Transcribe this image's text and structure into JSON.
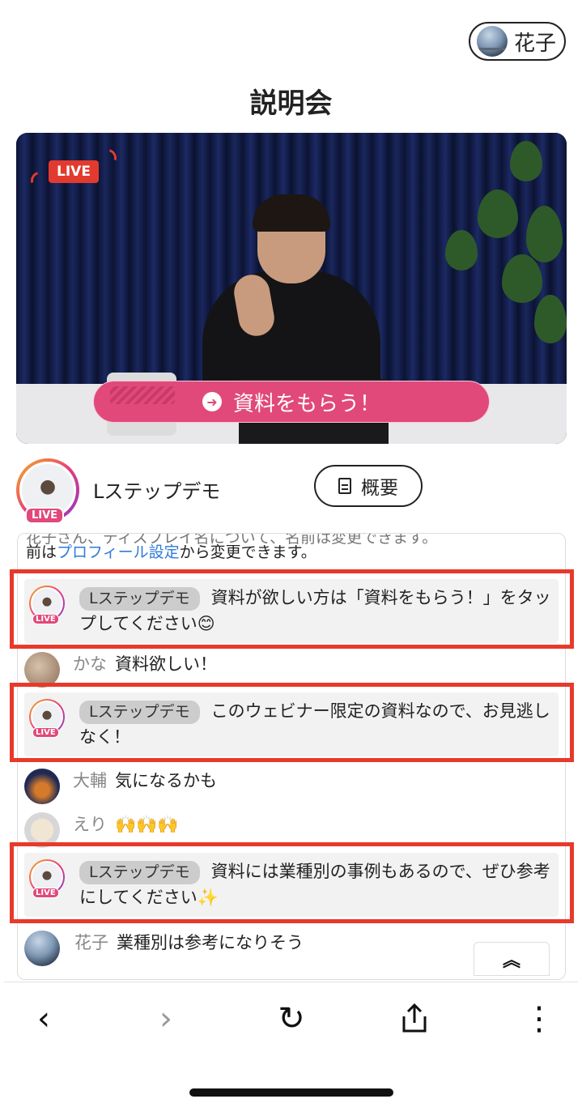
{
  "user": {
    "name": "花子"
  },
  "page": {
    "title": "説明会"
  },
  "video": {
    "live_label": "LIVE",
    "cta_label": "資料をもらう！"
  },
  "host": {
    "name": "Lステップデモ",
    "live_label": "LIVE",
    "summary_label": "概要"
  },
  "chat": {
    "notice_cut": "花子さん、ディスプレイ名について、名前は変更できます。",
    "notice_prefix": "前は",
    "notice_link": "プロフィール設定",
    "notice_suffix": "から変更できます。",
    "messages": [
      {
        "author": "Lステップデモ",
        "text": "資料が欲しい方は「資料をもらう！」をタップしてください😊"
      },
      {
        "author": "かな",
        "text": "資料欲しい！"
      },
      {
        "author": "Lステップデモ",
        "text": "このウェビナー限定の資料なので、お見逃しなく！"
      },
      {
        "author": "大輔",
        "text": "気になるかも"
      },
      {
        "author": "えり",
        "text": "🙌🙌🙌"
      },
      {
        "author": "Lステップデモ",
        "text": "資料には業種別の事例もあるので、ぜひ参考にしてください✨"
      },
      {
        "author": "花子",
        "text": "業種別は参考になりそう"
      }
    ],
    "scroll_top_icon": "chevron-double-up-icon"
  },
  "browser": {
    "back_icon": "‹",
    "forward_icon": "›",
    "reload_icon": "↻",
    "share_icon": "share-icon",
    "more_icon": "⋮"
  },
  "colors": {
    "accent": "#e0497a",
    "highlight": "#e8392b",
    "link": "#2f7bd9"
  }
}
